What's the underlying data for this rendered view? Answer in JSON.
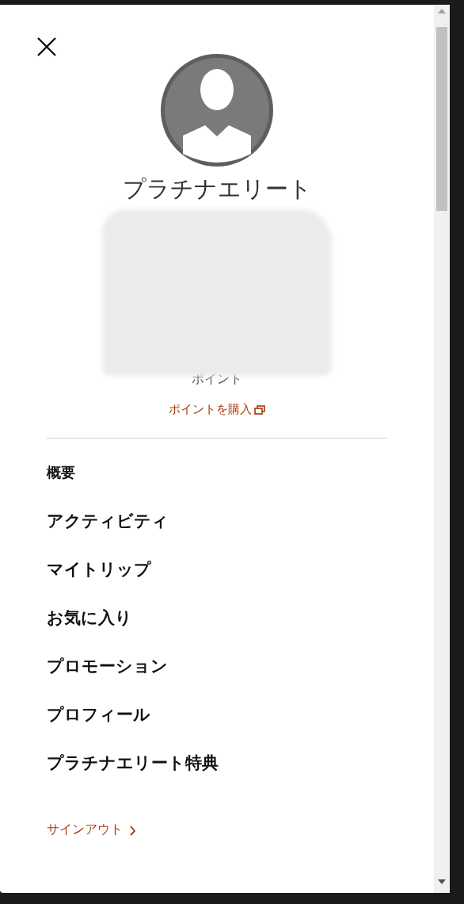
{
  "profile": {
    "tier": "プラチナエリート",
    "points_label": "ポイント",
    "buy_points_link": "ポイントを購入"
  },
  "menu": [
    {
      "label": "概要",
      "kind": "small"
    },
    {
      "label": "アクティビティ",
      "kind": "large"
    },
    {
      "label": "マイトリップ",
      "kind": "large"
    },
    {
      "label": "お気に入り",
      "kind": "large"
    },
    {
      "label": "プロモーション",
      "kind": "large"
    },
    {
      "label": "プロフィール",
      "kind": "large"
    },
    {
      "label": "プラチナエリート特典",
      "kind": "large"
    }
  ],
  "sign_out": "サインアウト"
}
